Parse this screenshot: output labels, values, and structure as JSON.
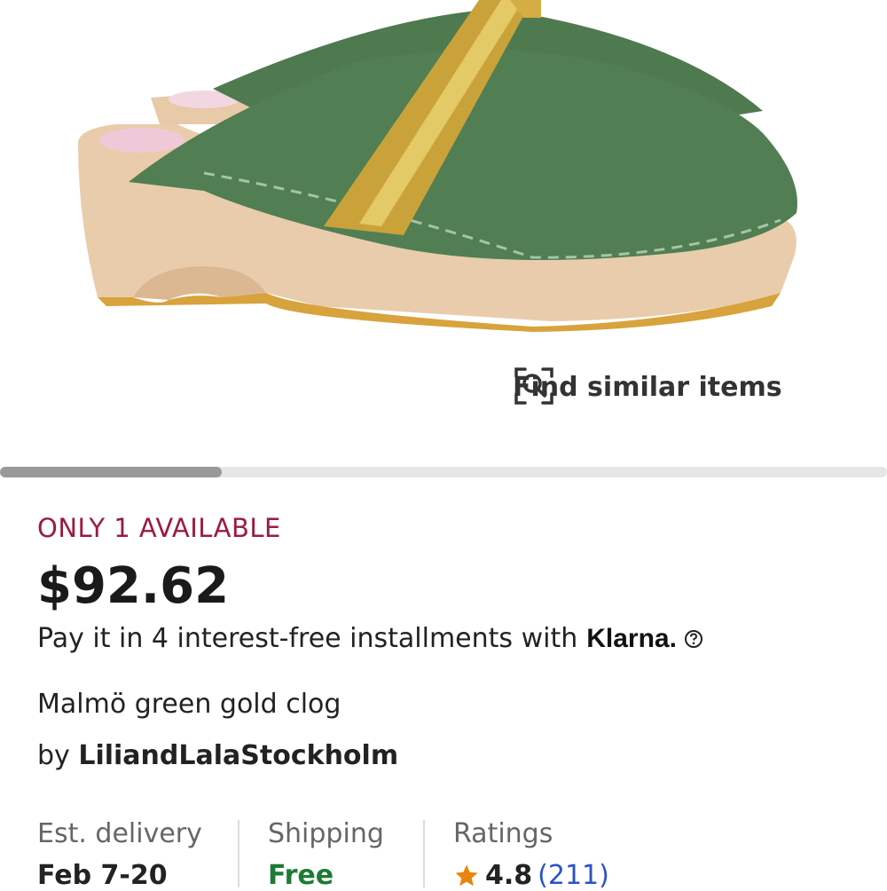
{
  "product_image": {
    "alt": "Green nubuck leather clog with gold strap on wooden base"
  },
  "find_similar": {
    "label": "Find similar items",
    "icon": "visual-search-icon"
  },
  "gallery": {
    "progress": 0.25
  },
  "availability": {
    "text": "ONLY 1 AVAILABLE",
    "color": "#9b1b3e"
  },
  "price": {
    "text": "$92.62"
  },
  "installments": {
    "text": "Pay it in 4 interest-free installments with",
    "provider": "Klarna.",
    "help_icon": "question-circle-icon"
  },
  "product": {
    "title": "Malmö green gold clog"
  },
  "seller": {
    "prefix": "by",
    "name": "LiliandLalaStockholm"
  },
  "info": {
    "delivery": {
      "label": "Est. delivery",
      "value": "Feb 7-20"
    },
    "shipping": {
      "label": "Shipping",
      "value": "Free",
      "value_color": "#1e7a34"
    },
    "ratings": {
      "label": "Ratings",
      "score": "4.8",
      "count": "(211)",
      "star_color": "#e8850c"
    }
  }
}
